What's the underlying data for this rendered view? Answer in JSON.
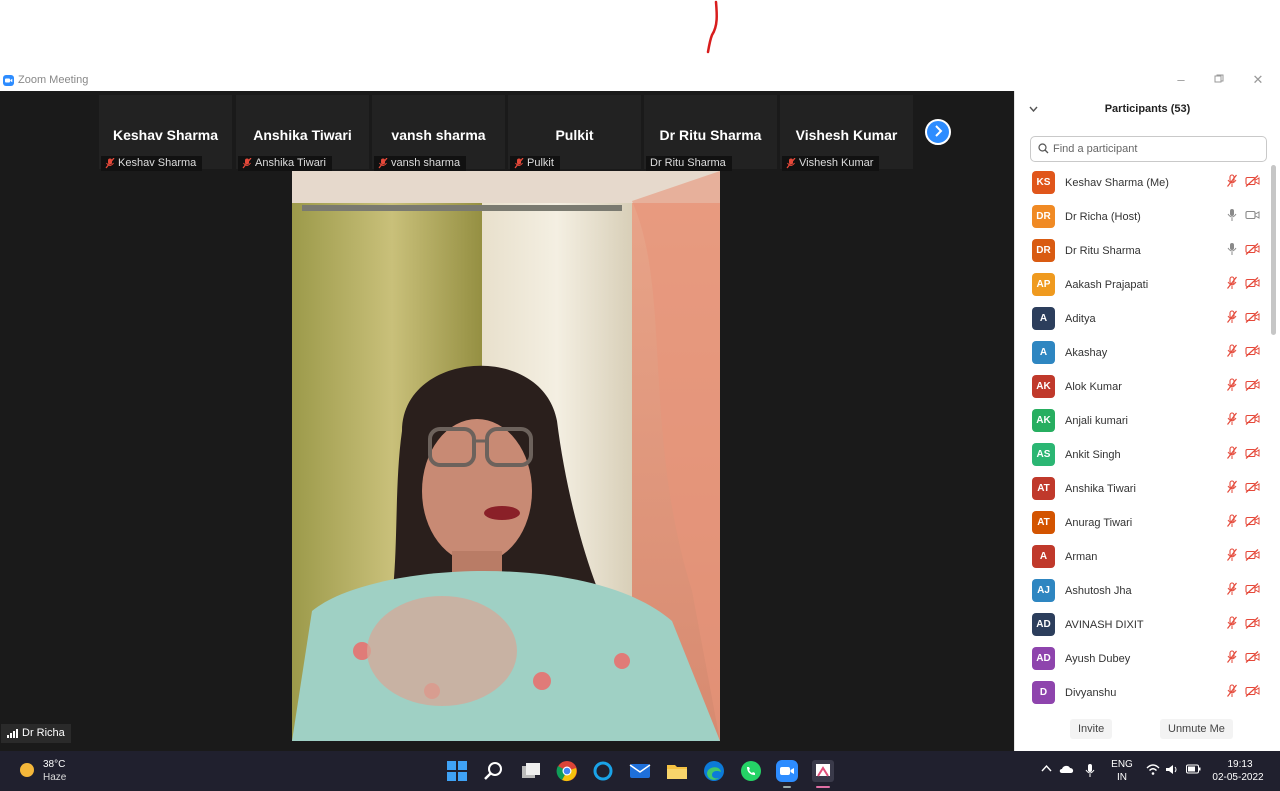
{
  "window": {
    "title": "Zoom Meeting"
  },
  "thumbnails": [
    {
      "display_name": "Keshav Sharma",
      "tag": "Keshav Sharma",
      "muted": true
    },
    {
      "display_name": "Anshika Tiwari",
      "tag": "Anshika Tiwari",
      "muted": true
    },
    {
      "display_name": "vansh sharma",
      "tag": "vansh sharma",
      "muted": true
    },
    {
      "display_name": "Pulkit",
      "tag": "Pulkit",
      "muted": true
    },
    {
      "display_name": "Dr Ritu Sharma",
      "tag": "Dr Ritu Sharma",
      "muted": false
    },
    {
      "display_name": "Vishesh Kumar",
      "tag": "Vishesh Kumar",
      "muted": true
    }
  ],
  "active_speaker": {
    "name": "Dr Richa"
  },
  "participants_panel": {
    "title": "Participants (53)",
    "search_placeholder": "Find a participant",
    "invite_label": "Invite",
    "unmute_label": "Unmute Me",
    "participants": [
      {
        "initials": "KS",
        "name": "Keshav Sharma (Me)",
        "color": "#e0561b",
        "mic": "muted",
        "cam": "off"
      },
      {
        "initials": "DR",
        "name": "Dr Richa (Host)",
        "color": "#f08a24",
        "mic": "on",
        "cam": "on"
      },
      {
        "initials": "DR",
        "name": "Dr Ritu Sharma",
        "color": "#d95b12",
        "mic": "on",
        "cam": "off"
      },
      {
        "initials": "AP",
        "name": "Aakash Prajapati",
        "color": "#ef9a1f",
        "mic": "muted",
        "cam": "off"
      },
      {
        "initials": "A",
        "name": "Aditya",
        "color": "#2c3e5c",
        "mic": "muted",
        "cam": "off"
      },
      {
        "initials": "A",
        "name": "Akashay",
        "color": "#2e86c1",
        "mic": "muted",
        "cam": "off"
      },
      {
        "initials": "AK",
        "name": "Alok Kumar",
        "color": "#c0392b",
        "mic": "muted",
        "cam": "off"
      },
      {
        "initials": "AK",
        "name": "Anjali kumari",
        "color": "#27ae60",
        "mic": "muted",
        "cam": "off"
      },
      {
        "initials": "AS",
        "name": "Ankit Singh",
        "color": "#2bb673",
        "mic": "muted",
        "cam": "off"
      },
      {
        "initials": "AT",
        "name": "Anshika Tiwari",
        "color": "#c0392b",
        "mic": "muted",
        "cam": "off"
      },
      {
        "initials": "AT",
        "name": "Anurag Tiwari",
        "color": "#d35400",
        "mic": "muted",
        "cam": "off"
      },
      {
        "initials": "A",
        "name": "Arman",
        "color": "#c0392b",
        "mic": "muted",
        "cam": "off"
      },
      {
        "initials": "AJ",
        "name": "Ashutosh Jha",
        "color": "#2e86c1",
        "mic": "muted",
        "cam": "off"
      },
      {
        "initials": "AD",
        "name": "AVINASH DIXIT",
        "color": "#2c3e5c",
        "mic": "muted",
        "cam": "off"
      },
      {
        "initials": "AD",
        "name": "Ayush Dubey",
        "color": "#8e44ad",
        "mic": "muted",
        "cam": "off"
      },
      {
        "initials": "D",
        "name": "Divyanshu",
        "color": "#8e44ad",
        "mic": "muted",
        "cam": "off"
      }
    ]
  },
  "taskbar": {
    "weather_temp": "38°C",
    "weather_desc": "Haze",
    "lang": "ENG",
    "region": "IN",
    "time": "19:13",
    "date": "02-05-2022"
  }
}
